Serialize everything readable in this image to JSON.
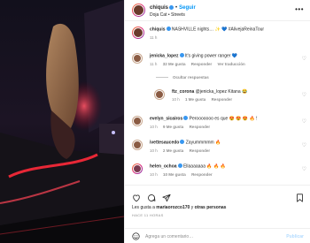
{
  "post": {
    "author": "chiquis",
    "follow_label": "Seguir",
    "separator": "•",
    "audio": "Doja Cat • Streets",
    "menu_icon": "more-horizontal-icon"
  },
  "caption": {
    "author": "chiquis",
    "text": "NASHVILLE nights… ✨ 💙 #AlivejaReinaTour",
    "time": "11 h"
  },
  "comments": [
    {
      "author": "jenicka_lopez",
      "text": "It's giving power ranger 💙",
      "time": "11 h",
      "likes": "32 Me gusta",
      "reply": "Responder",
      "translate": "Ver traducción"
    },
    {
      "author": "ftz_corona",
      "text": "@jenicka_lopez Kitana 😂",
      "time": "10 h",
      "likes": "1 Me gusta",
      "reply": "Responder"
    },
    {
      "author": "evelyn_sicairos",
      "text": "Perooooooo es que 😍 😍 😍 🔥 !",
      "time": "10 h",
      "likes": "9 Me gusta",
      "reply": "Responder"
    },
    {
      "author": "ivettesaucedo",
      "text": "Zayummmmm 🔥",
      "time": "10 h",
      "likes": "2 Me gusta",
      "reply": "Responder"
    },
    {
      "author": "helen_ochoa",
      "text": "Ellaaaaaaa 🔥 🔥 🔥",
      "time": "10 h",
      "likes": "10 Me gusta",
      "reply": "Responder"
    }
  ],
  "hide_replies_label": "Ocultar respuestas",
  "footer": {
    "likes_prefix": "Les gusta a",
    "likes_user": "mariaorozco170",
    "likes_and": "y",
    "likes_others": "otras personas",
    "time": "HACE 11 HORAS"
  },
  "add_comment": {
    "placeholder": "Agrega un comentario…",
    "publish_label": "Publicar"
  },
  "colors": {
    "accent": "#0095f6",
    "verified": "#3897f0"
  }
}
